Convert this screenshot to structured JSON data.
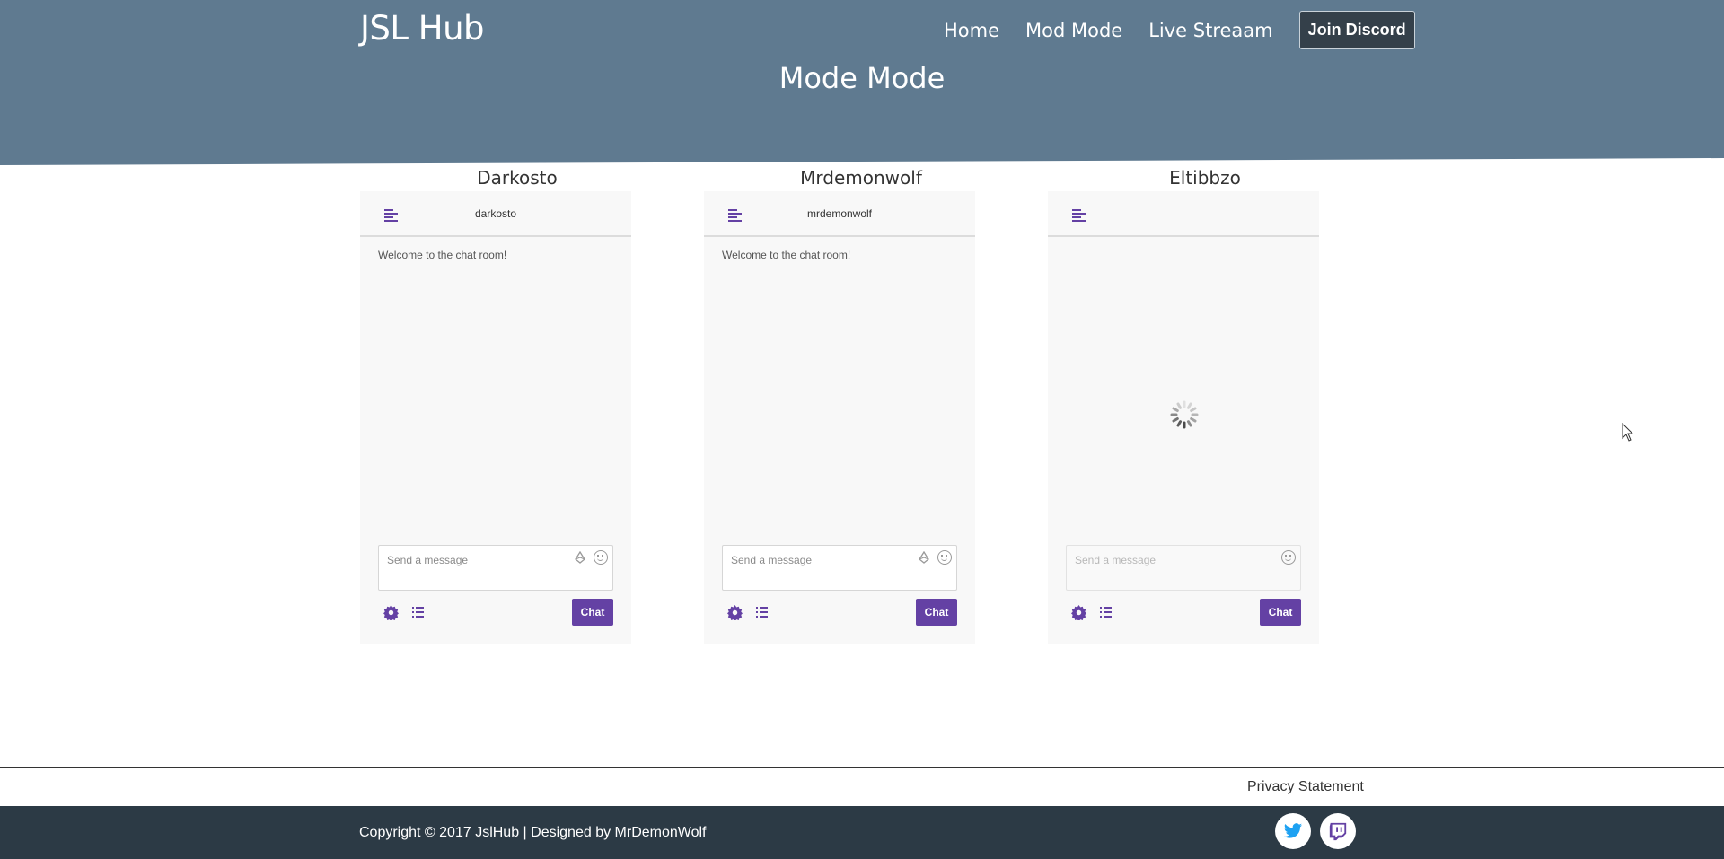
{
  "header": {
    "brand": "JSL Hub",
    "nav": [
      "Home",
      "Mod Mode",
      "Live Streaam"
    ],
    "discord_button": "Join Discord",
    "page_title": "Mode Mode"
  },
  "panels": [
    {
      "title": "Darkosto",
      "channel": "darkosto",
      "welcome": "Welcome to the chat room!",
      "placeholder": "Send a message",
      "chat_button": "Chat",
      "loading": false
    },
    {
      "title": "Mrdemonwolf",
      "channel": "mrdemonwolf",
      "welcome": "Welcome to the chat room!",
      "placeholder": "Send a message",
      "chat_button": "Chat",
      "loading": false
    },
    {
      "title": "Eltibbzo",
      "channel": "",
      "welcome": "",
      "placeholder": "Send a message",
      "chat_button": "Chat",
      "loading": true
    }
  ],
  "footer": {
    "privacy": "Privacy Statement",
    "copyright": "Copyright © 2017 JslHub | Designed by MrDemonWolf",
    "social": [
      "twitter-icon",
      "twitch-icon"
    ]
  },
  "colors": {
    "hero": "#5f7a90",
    "twitch_purple": "#6441a4",
    "footer": "#2c3a45",
    "twitter": "#1da1f2"
  }
}
